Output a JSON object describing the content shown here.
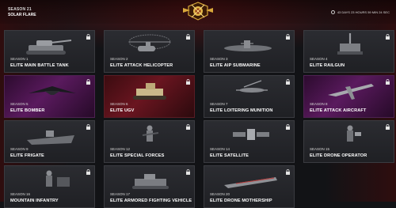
{
  "header": {
    "season_label": "SEASON 21",
    "season_name": "SOLAR FLARE",
    "timer": "43 DAYS 23 HOURS 59 MIN 24 SEC"
  },
  "cards": [
    {
      "season": "SEASON 1",
      "title": "ELITE MAIN BATTLE TANK",
      "icon": "tank-icon"
    },
    {
      "season": "SEASON 2",
      "title": "ELITE ATTACK HELICOPTER",
      "icon": "helicopter-icon"
    },
    {
      "season": "SEASON 3",
      "title": "ELITE AIP SUBMARINE",
      "icon": "submarine-icon"
    },
    {
      "season": "SEASON 4",
      "title": "ELITE RAILGUN",
      "icon": "railgun-icon"
    },
    {
      "season": "SEASON 5",
      "title": "ELITE BOMBER",
      "icon": "bomber-icon"
    },
    {
      "season": "SEASON 6",
      "title": "ELITE UGV",
      "icon": "ugv-icon"
    },
    {
      "season": "SEASON 7",
      "title": "ELITE LOITERING MUNITION",
      "icon": "drone-icon"
    },
    {
      "season": "SEASON 8",
      "title": "ELITE ATTACK AIRCRAFT",
      "icon": "aircraft-icon"
    },
    {
      "season": "SEASON 9",
      "title": "ELITE FRIGATE",
      "icon": "frigate-icon"
    },
    {
      "season": "SEASON 12",
      "title": "ELITE SPECIAL FORCES",
      "icon": "soldier-icon"
    },
    {
      "season": "SEASON 14",
      "title": "ELITE SATELLITE",
      "icon": "satellite-icon"
    },
    {
      "season": "SEASON 15",
      "title": "ELITE DRONE OPERATOR",
      "icon": "operator-icon"
    },
    {
      "season": "SEASON 16",
      "title": "MOUNTAIN INFANTRY",
      "icon": "infantry-icon"
    },
    {
      "season": "SEASON 17",
      "title": "ELITE ARMORED FIGHTING VEHICLE",
      "icon": "ifv-icon"
    },
    {
      "season": "SEASON 20",
      "title": "ELITE DRONE MOTHERSHIP",
      "icon": "mothership-icon"
    }
  ]
}
